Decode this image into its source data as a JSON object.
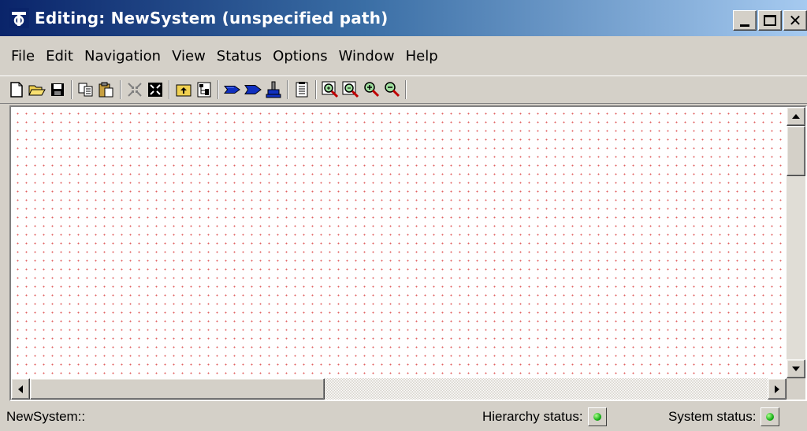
{
  "window": {
    "title": "Editing:  NewSystem  (unspecified path)",
    "title_colors": {
      "left": "#0a246a",
      "right": "#a6caf0"
    }
  },
  "menu": [
    "File",
    "Edit",
    "Navigation",
    "View",
    "Status",
    "Options",
    "Window",
    "Help"
  ],
  "toolbar": {
    "icons": [
      "new-file-icon",
      "open-folder-icon",
      "save-icon",
      "copy-icon",
      "paste-icon",
      "collapse-icon",
      "expand-icon",
      "up-level-icon",
      "hierarchy-icon",
      "arrow-right-icon",
      "arrow-right-bold-icon",
      "stamp-icon",
      "document-icon",
      "zoom-region-icon",
      "zoom-fit-icon",
      "zoom-in-icon",
      "zoom-out-icon"
    ]
  },
  "canvas": {
    "dot_color": "#e06060",
    "background": "#ffffff"
  },
  "statusbar": {
    "path": "NewSystem::",
    "hierarchy_label": "Hierarchy status:",
    "system_label": "System status:",
    "status_color": "#18b018"
  }
}
